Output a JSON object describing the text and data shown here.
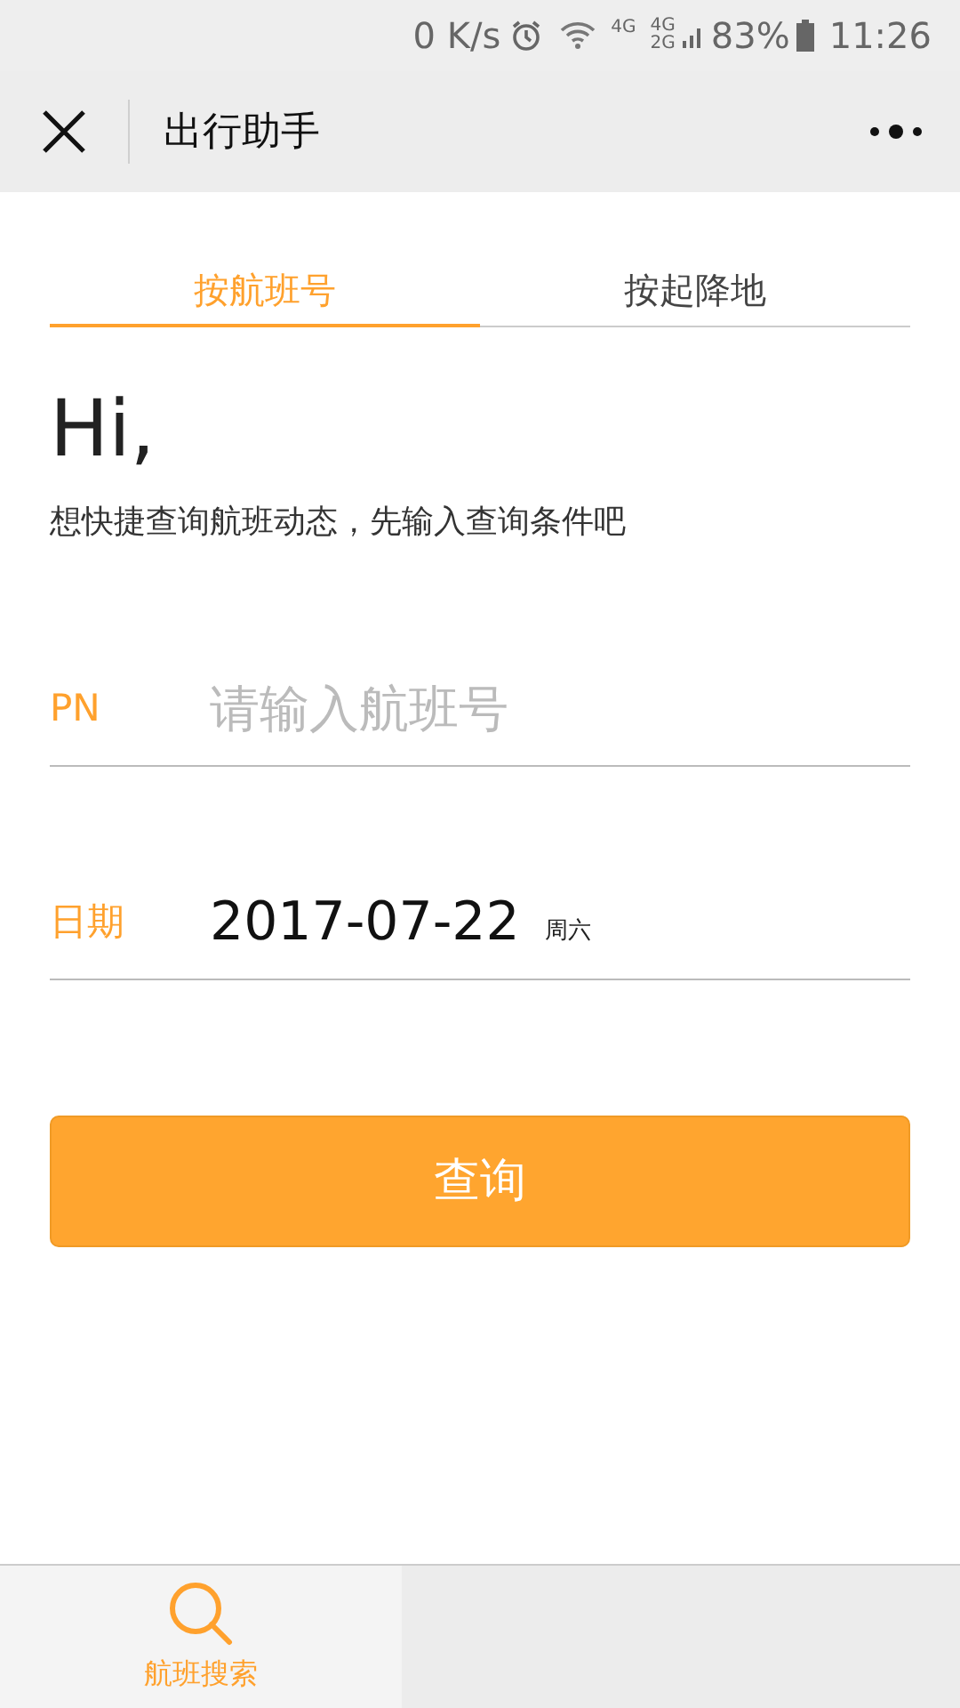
{
  "status_bar": {
    "speed": "0 K/s",
    "network_1": "4G",
    "network_2_top": "4G",
    "network_2_bottom": "2G",
    "battery": "83%",
    "time": "11:26"
  },
  "nav_bar": {
    "title": "出行助手"
  },
  "tabs": [
    {
      "label": "按航班号",
      "selected": true
    },
    {
      "label": "按起降地",
      "selected": false
    }
  ],
  "greeting": "Hi,",
  "subtitle": "想快捷查询航班动态，先输入查询条件吧",
  "fields": [
    {
      "kind": "input",
      "label": "PN",
      "placeholder": "请输入航班号"
    },
    {
      "kind": "date",
      "label": "日期",
      "value": "2017-07-22",
      "weekday": "周六"
    }
  ],
  "submit_button": "查询",
  "bottom_tabs": [
    {
      "label": "航班搜索",
      "selected": true
    }
  ]
}
